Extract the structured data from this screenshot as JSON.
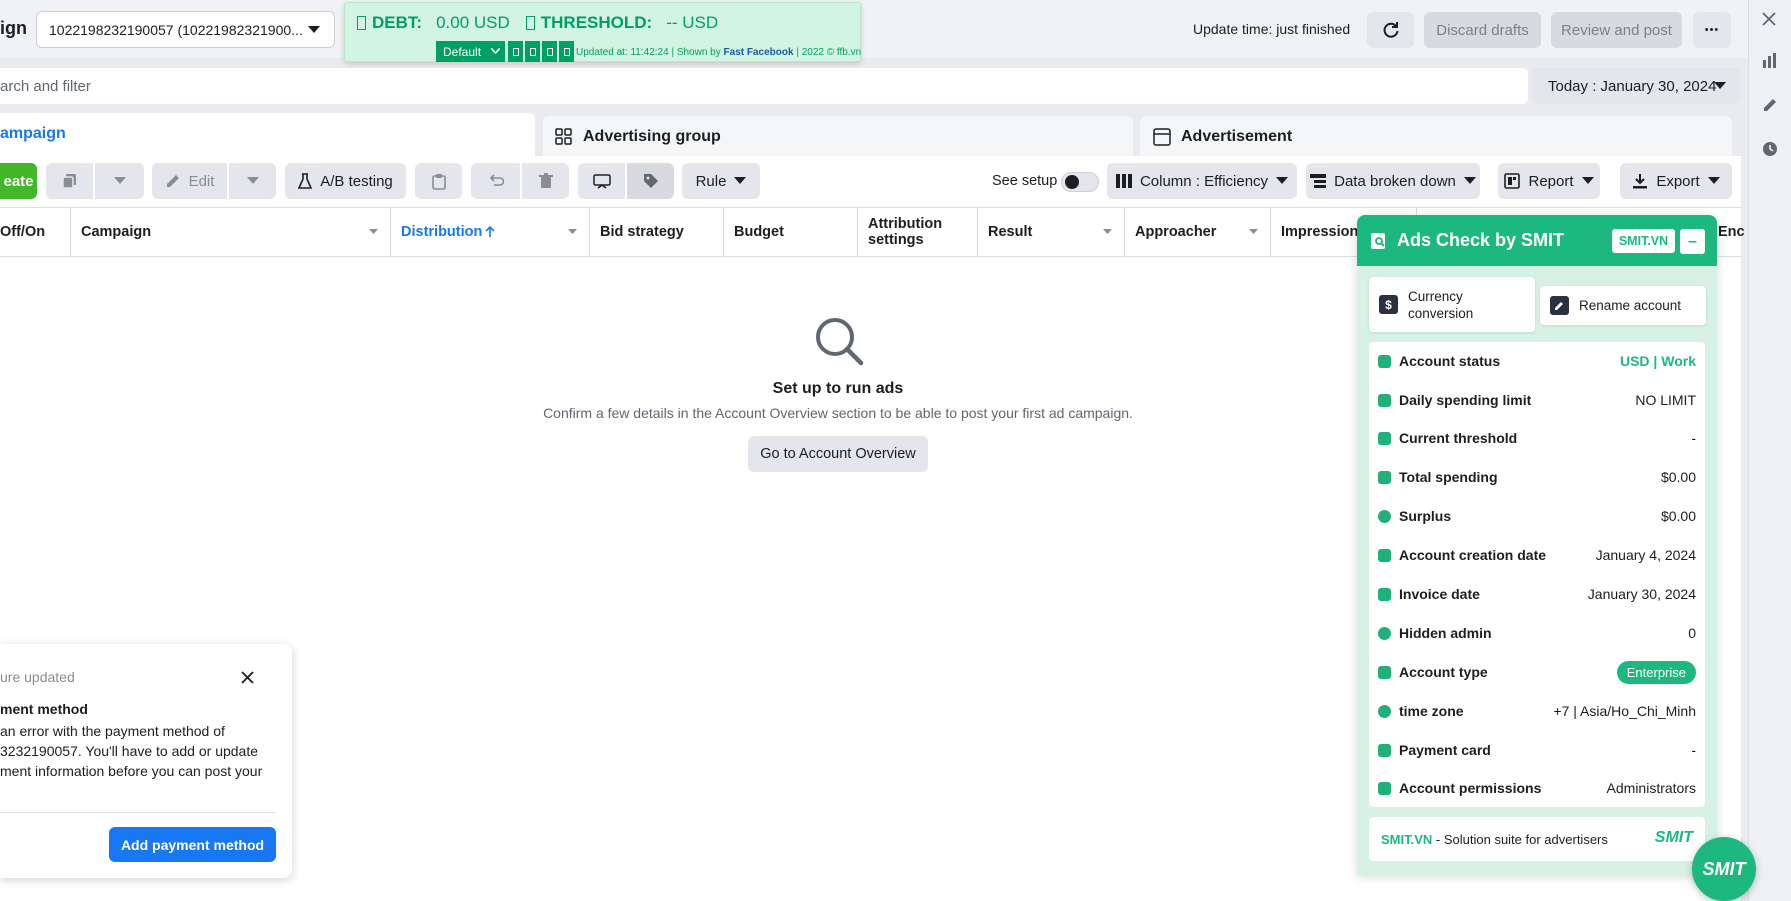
{
  "header": {
    "page_label": "ign",
    "account_select": "1022198232190057 (10221982321900...",
    "update_time": "Update time: just finished",
    "discard_label": "Discard drafts",
    "review_label": "Review and post",
    "more_label": "•••"
  },
  "ffb": {
    "debt_label": "DEBT:",
    "debt_value": "0.00 USD",
    "threshold_label": "THRESHOLD:",
    "threshold_value": "-- USD",
    "preset": "Default",
    "updated_text": "Updated at: 11:42:24 | Shown by",
    "fast_facebook": "Fast Facebook",
    "copyright": "| 2022 © ffb.vn",
    "color": "#00a060"
  },
  "search": {
    "placeholder": "arch and filter",
    "date_label": "Today : January 30, 2024"
  },
  "tabs": {
    "campaign": "ampaign",
    "ad_group": "Advertising group",
    "advertisement": "Advertisement"
  },
  "toolbar": {
    "create": "eate",
    "edit": "Edit",
    "ab_testing": "A/B testing",
    "rule": "Rule",
    "see_setup": "See setup",
    "column": "Column : Efficiency",
    "breakdown": "Data broken down",
    "report": "Report",
    "export": "Export"
  },
  "table": {
    "columns": [
      "Off/On",
      "Campaign",
      "Distribution",
      "Bid strategy",
      "Budget",
      "Attribution settings",
      "Result",
      "Approacher",
      "Impressions",
      "Enc"
    ]
  },
  "empty_state": {
    "title": "Set up to run ads",
    "description": "Confirm a few details in the Account Overview section to be able to post your first ad campaign.",
    "button": "Go to Account Overview"
  },
  "notification": {
    "header": "ure updated",
    "title": "ment method",
    "body_line1": "an error with the payment method of",
    "body_line2": "3232190057. You'll have to add or update",
    "body_line3": "ment information before you can post your",
    "button": "Add payment method"
  },
  "smit": {
    "title": "Ads Check by SMIT",
    "badge": "SMIT.VN",
    "minimize": "–",
    "currency_btn": "Currency conversion",
    "rename_btn": "Rename account",
    "rows": [
      {
        "label": "Account status",
        "value": "USD | Work"
      },
      {
        "label": "Daily spending limit",
        "value": "NO LIMIT"
      },
      {
        "label": "Current threshold",
        "value": "-"
      },
      {
        "label": "Total spending",
        "value": "$0.00"
      },
      {
        "label": "Surplus",
        "value": "$0.00"
      },
      {
        "label": "Account creation date",
        "value": "January 4, 2024"
      },
      {
        "label": "Invoice date",
        "value": "January 30, 2024"
      },
      {
        "label": "Hidden admin",
        "value": "0"
      },
      {
        "label": "Account type",
        "value": "Enterprise"
      },
      {
        "label": "time zone",
        "value": "+7 | Asia/Ho_Chi_Minh"
      },
      {
        "label": "Payment card",
        "value": "-"
      },
      {
        "label": "Account permissions",
        "value": "Administrators"
      }
    ],
    "footer_brand": "SMIT.VN",
    "footer_text": " - Solution suite for advertisers",
    "logo": "SMIT",
    "accent": "#1db87f"
  },
  "fab_label": "SMIT"
}
